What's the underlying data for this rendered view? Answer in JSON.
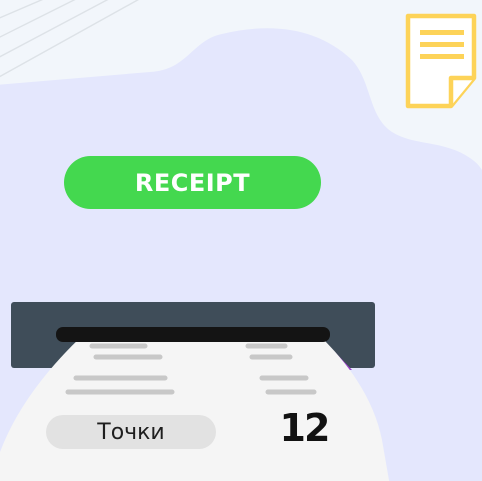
{
  "receipt_button": {
    "label": "RECEIPT"
  },
  "score": {
    "label": "Точки",
    "value": "12"
  },
  "icons": {
    "corner": "document-icon"
  },
  "colors": {
    "button_green": "#44d84f",
    "panel_lavender": "#e4e7fd",
    "slot_dark": "#3f4d59",
    "paper": "#f5f5f5",
    "icon_yellow": "#fdd358",
    "paper_edge_purple": "#9b40c9"
  }
}
